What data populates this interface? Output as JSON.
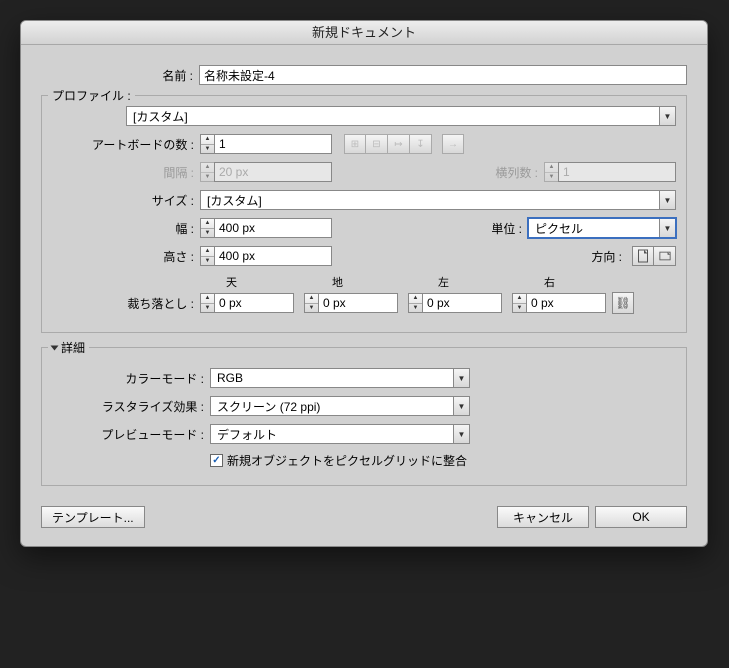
{
  "title": "新規ドキュメント",
  "name": {
    "label": "名前 :",
    "value": "名称未設定-4"
  },
  "profile": {
    "label": "プロファイル :",
    "value": "[カスタム]"
  },
  "artboards": {
    "count_label": "アートボードの数 :",
    "count_value": "1",
    "spacing_label": "間隔 :",
    "spacing_value": "20 px",
    "columns_label": "横列数 :",
    "columns_value": "1"
  },
  "size": {
    "label": "サイズ :",
    "value": "[カスタム]"
  },
  "width": {
    "label": "幅 :",
    "value": "400 px"
  },
  "height": {
    "label": "高さ :",
    "value": "400 px"
  },
  "units": {
    "label": "単位 :",
    "value": "ピクセル"
  },
  "orientation": {
    "label": "方向 :"
  },
  "bleed": {
    "label": "裁ち落とし :",
    "top_h": "天",
    "bottom_h": "地",
    "left_h": "左",
    "right_h": "右",
    "top": "0 px",
    "bottom": "0 px",
    "left": "0 px",
    "right": "0 px"
  },
  "advanced": {
    "legend": "詳細",
    "colormode_label": "カラーモード :",
    "colormode_value": "RGB",
    "raster_label": "ラスタライズ効果 :",
    "raster_value": "スクリーン (72 ppi)",
    "preview_label": "プレビューモード :",
    "preview_value": "デフォルト",
    "align_label": "新規オブジェクトをピクセルグリッドに整合"
  },
  "buttons": {
    "template": "テンプレート...",
    "cancel": "キャンセル",
    "ok": "OK"
  }
}
